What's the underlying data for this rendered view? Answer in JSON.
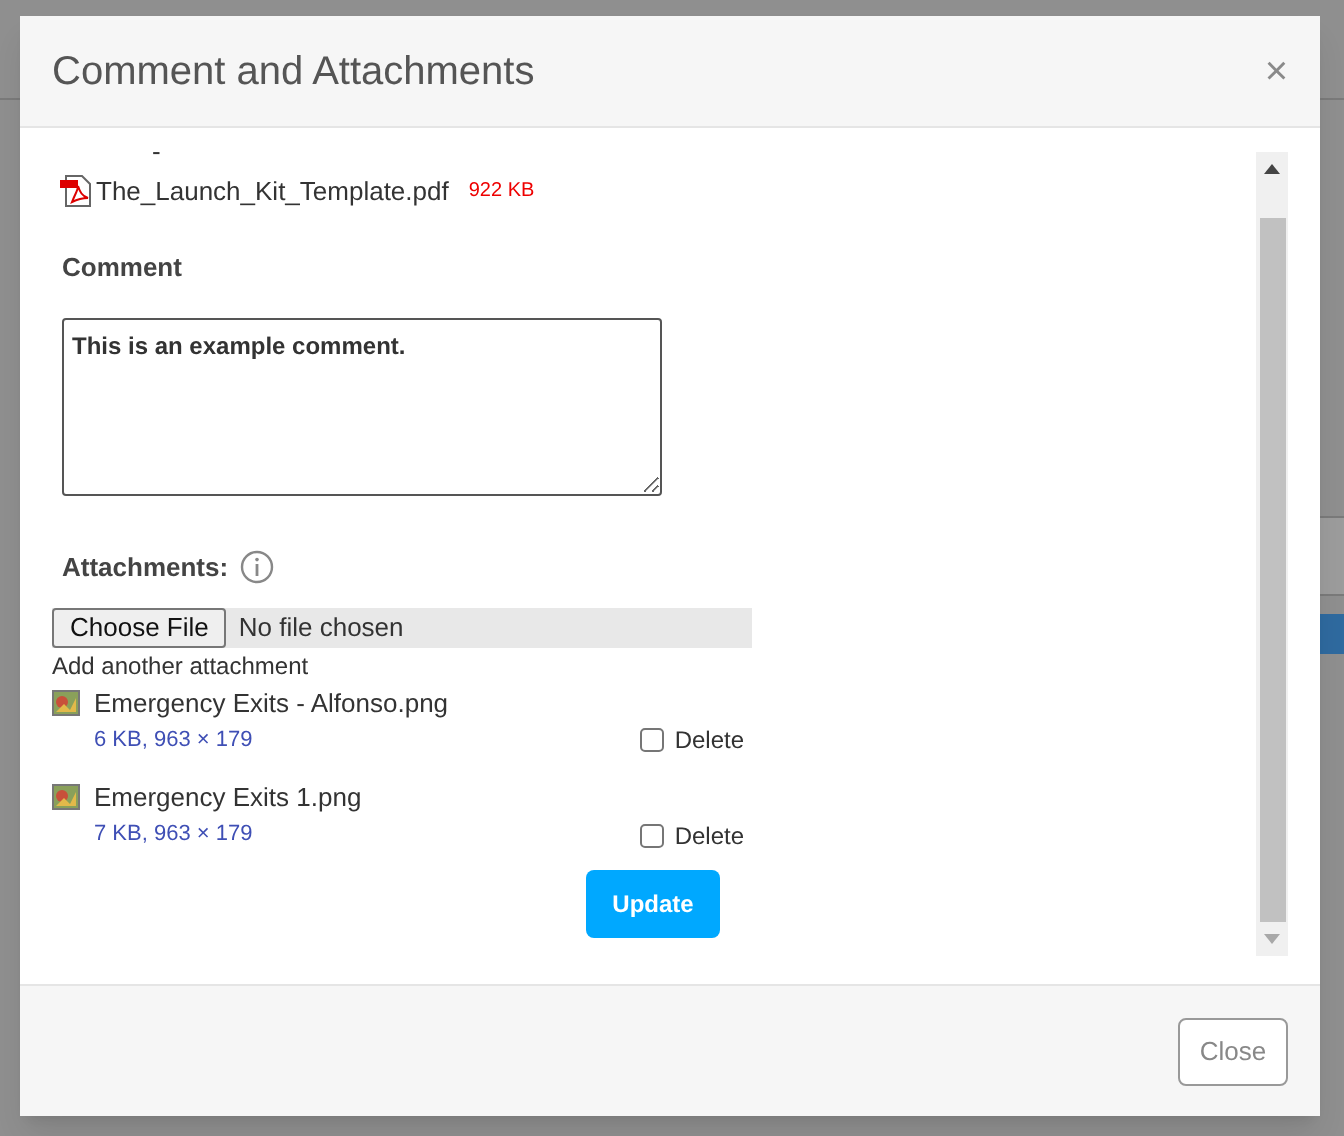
{
  "dialog": {
    "title": "Comment and Attachments",
    "close_glyph": "×"
  },
  "scrolled_fragment": "-",
  "document": {
    "name": "The_Launch_Kit_Template.pdf",
    "size": "922 KB"
  },
  "comment": {
    "label": "Comment",
    "value": "This is an example comment."
  },
  "attachments": {
    "label": "Attachments:",
    "file_button": "Choose File",
    "file_status": "No file chosen",
    "add_link": "Add another attachment",
    "items": [
      {
        "name": "Emergency Exits - Alfonso.png",
        "info": "6 KB, 963 × 179",
        "delete_label": "Delete",
        "checked": false
      },
      {
        "name": "Emergency Exits 1.png",
        "info": "7 KB, 963 × 179",
        "delete_label": "Delete",
        "checked": false
      }
    ]
  },
  "update_button": "Update",
  "footer_button": "Close"
}
